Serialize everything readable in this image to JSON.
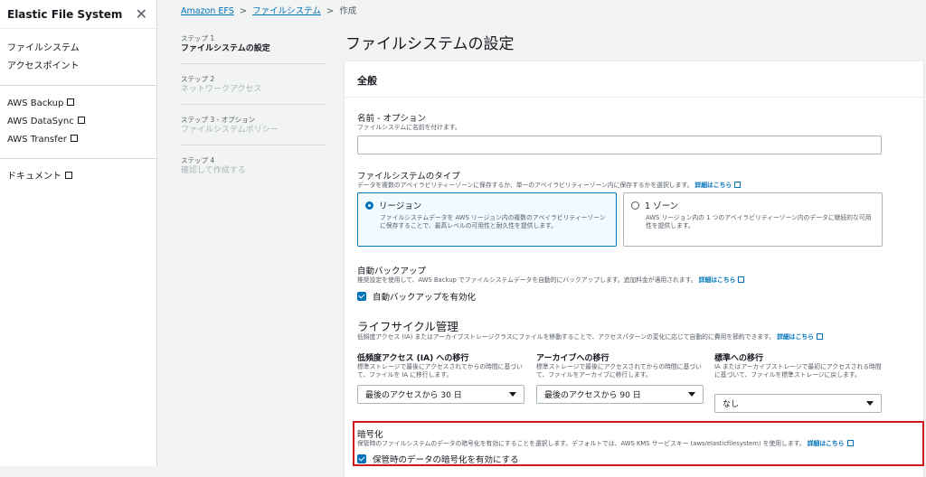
{
  "sidebar": {
    "title": "Elastic File System",
    "close_icon": "close-icon",
    "group1": [
      "ファイルシステム",
      "アクセスポイント"
    ],
    "group2": [
      "AWS Backup",
      "AWS DataSync",
      "AWS Transfer"
    ],
    "group3": [
      "ドキュメント"
    ]
  },
  "breadcrumb": {
    "items": [
      "Amazon EFS",
      "ファイルシステム",
      "作成"
    ],
    "separator": ">"
  },
  "steps": [
    {
      "num": "ステップ 1",
      "label": "ファイルシステムの設定"
    },
    {
      "num": "ステップ 2",
      "label": "ネットワークアクセス"
    },
    {
      "num": "ステップ 3 - オプション",
      "label": "ファイルシステムポリシー"
    },
    {
      "num": "ステップ 4",
      "label": "確認して作成する"
    }
  ],
  "page_title": "ファイルシステムの設定",
  "panel": {
    "header": "全般",
    "name": {
      "label": "名前 - オプション",
      "desc": "ファイルシステムに名前を付けます。",
      "value": ""
    },
    "fs_type": {
      "label": "ファイルシステムのタイプ",
      "desc": "データを複数のアベイラビリティーゾーンに保存するか、単一のアベイラビリティーゾーン内に保存するかを選択します。",
      "learn_more": "詳細はこちら",
      "options": [
        {
          "title": "リージョン",
          "desc": "ファイルシステムデータを AWS リージョン内の複数のアベイラビリティーゾーンに保存することで、最高レベルの可用性と耐久性を提供します。"
        },
        {
          "title": "1 ゾーン",
          "desc": "AWS リージョン内の 1 つのアベイラビリティーゾーン内のデータに継続的な可用性を提供します。"
        }
      ],
      "selected": "リージョン"
    },
    "backup": {
      "label": "自動バックアップ",
      "desc": "推奨設定を使用して、AWS Backup でファイルシステムデータを自動的にバックアップします。追加料金が適用されます。",
      "learn_more": "詳細はこちら",
      "checkbox_label": "自動バックアップを有効化",
      "checked": true
    },
    "lifecycle": {
      "title": "ライフサイクル管理",
      "desc": "低頻度アクセス (IA) またはアーカイブストレージクラスにファイルを移動することで、アクセスパターンの変化に応じて自動的に費用を節約できます。",
      "learn_more": "詳細はこちら",
      "ia": {
        "label": "低頻度アクセス (IA) への移行",
        "desc": "標準ストレージで最後にアクセスされてからの時間に基づいて、ファイルを IA に移行します。",
        "value": "最後のアクセスから 30 日"
      },
      "archive": {
        "label": "アーカイブへの移行",
        "desc": "標準ストレージで最後にアクセスされてからの時間に基づいて、ファイルをアーカイブに移行します。",
        "value": "最後のアクセスから 90 日"
      },
      "standard": {
        "label": "標準への移行",
        "desc": "IA またはアーカイブストレージで最初にアクセスされる時間に基づいて、ファイルを標準ストレージに戻します。",
        "value": "なし"
      }
    },
    "encryption": {
      "label": "暗号化",
      "desc": "保管時のファイルシステムのデータの暗号化を有効にすることを選択します。デフォルトでは、AWS KMS サービスキー (aws/elasticfilesystem) を使用します。",
      "learn_more": "詳細はこちら",
      "checkbox_label": "保管時のデータの暗号化を有効にする",
      "checked": true
    }
  },
  "colors": {
    "link": "#0073bb",
    "highlight_border": "#d0191d"
  }
}
